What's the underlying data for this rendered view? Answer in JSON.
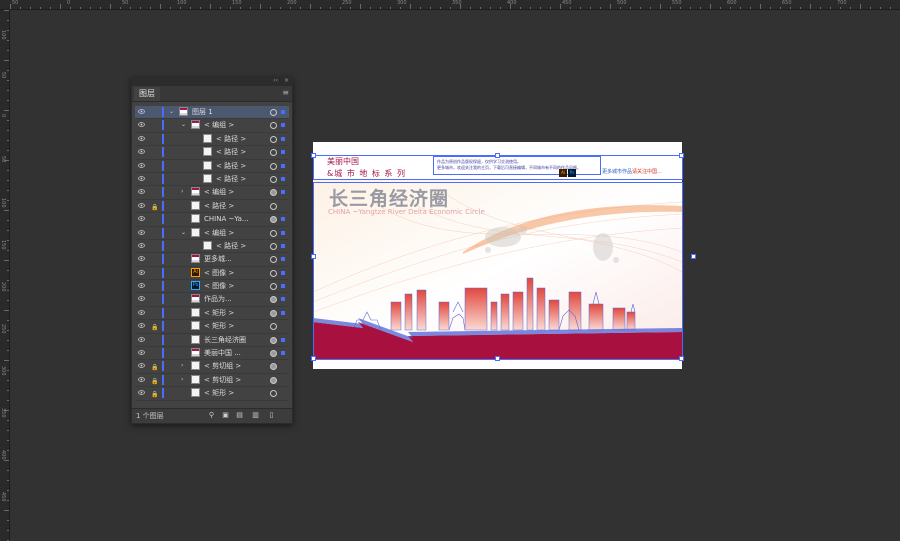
{
  "ruler_top_labels": [
    "50",
    "0",
    "50",
    "100",
    "150",
    "200",
    "250",
    "300",
    "350",
    "400",
    "450",
    "500",
    "550",
    "600",
    "650",
    "700"
  ],
  "ruler_left_labels": [
    "100",
    "50",
    "0",
    "50",
    "100",
    "150",
    "200",
    "250",
    "300",
    "350",
    "400",
    "450"
  ],
  "panel": {
    "tab_label": "图层",
    "collapse_icon": "double-chevron-icon",
    "close_icon": "close-icon",
    "menu_icon": "hamburger-menu-icon",
    "footer_count": "1 个图层",
    "layers": [
      {
        "name": "图层 1",
        "indent": 0,
        "expander": "open",
        "thumb": "doc",
        "lock": false,
        "selected": true,
        "target": "ring",
        "sel": true
      },
      {
        "name": "< 编组 >",
        "indent": 1,
        "expander": "open",
        "thumb": "doc",
        "lock": false,
        "target": "ring",
        "sel": true
      },
      {
        "name": "< 路径 >",
        "indent": 2,
        "expander": "none",
        "thumb": "white",
        "lock": false,
        "target": "ring",
        "sel": true
      },
      {
        "name": "< 路径 >",
        "indent": 2,
        "expander": "none",
        "thumb": "white",
        "lock": false,
        "target": "ring",
        "sel": true
      },
      {
        "name": "< 路径 >",
        "indent": 2,
        "expander": "none",
        "thumb": "white",
        "lock": false,
        "target": "ring",
        "sel": true
      },
      {
        "name": "< 路径 >",
        "indent": 2,
        "expander": "none",
        "thumb": "white",
        "lock": false,
        "target": "ring",
        "sel": true
      },
      {
        "name": "< 编组 >",
        "indent": 1,
        "expander": "closed",
        "thumb": "doc",
        "lock": false,
        "target": "filled",
        "sel": true
      },
      {
        "name": "< 路径 >",
        "indent": 1,
        "expander": "none",
        "thumb": "white",
        "lock": true,
        "target": "ring",
        "sel": false
      },
      {
        "name": "CHINA ~Ya...",
        "indent": 1,
        "expander": "none",
        "thumb": "white",
        "lock": false,
        "target": "filled",
        "sel": true
      },
      {
        "name": "< 编组 >",
        "indent": 1,
        "expander": "open",
        "thumb": "white",
        "lock": false,
        "target": "ring",
        "sel": true
      },
      {
        "name": "< 路径 >",
        "indent": 2,
        "expander": "none",
        "thumb": "white",
        "lock": false,
        "target": "ring",
        "sel": true
      },
      {
        "name": "更多城...",
        "indent": 1,
        "expander": "none",
        "thumb": "doc",
        "lock": false,
        "target": "ring",
        "sel": true
      },
      {
        "name": "< 图像 >",
        "indent": 1,
        "expander": "none",
        "thumb": "ai",
        "lock": false,
        "target": "ring",
        "sel": true
      },
      {
        "name": "< 图像 >",
        "indent": 1,
        "expander": "none",
        "thumb": "ps",
        "lock": false,
        "target": "ring",
        "sel": true
      },
      {
        "name": "作品为...",
        "indent": 1,
        "expander": "none",
        "thumb": "doc",
        "lock": false,
        "target": "filled",
        "sel": true
      },
      {
        "name": "< 矩形 >",
        "indent": 1,
        "expander": "none",
        "thumb": "white",
        "lock": false,
        "target": "filled",
        "sel": true
      },
      {
        "name": "< 矩形 >",
        "indent": 1,
        "expander": "none",
        "thumb": "white",
        "lock": true,
        "target": "ring",
        "sel": false
      },
      {
        "name": "长三角经济圈",
        "indent": 1,
        "expander": "none",
        "thumb": "white",
        "lock": false,
        "target": "filled",
        "sel": true
      },
      {
        "name": "美丽中国 ...",
        "indent": 1,
        "expander": "none",
        "thumb": "doc",
        "lock": false,
        "target": "filled",
        "sel": true
      },
      {
        "name": "< 剪切组 >",
        "indent": 1,
        "expander": "closed",
        "thumb": "white",
        "lock": true,
        "target": "filled",
        "sel": false
      },
      {
        "name": "< 剪切组 >",
        "indent": 1,
        "expander": "closed",
        "thumb": "white",
        "lock": true,
        "target": "filled",
        "sel": false
      },
      {
        "name": "< 矩形 >",
        "indent": 1,
        "expander": "none",
        "thumb": "white",
        "lock": true,
        "target": "ring",
        "sel": false
      }
    ],
    "footer_icons": [
      "search-icon",
      "export-icon",
      "make-clip-mask-icon",
      "new-sublayer-icon",
      "new-layer-icon",
      "trash-icon"
    ]
  },
  "poster": {
    "title_line1": "美丽中国",
    "title_line2": "&城 市 地 标 系 列",
    "notice_line1": "作品为原创作品版权保留，仅供学习交流使用。",
    "notice_line2": "更多城市，欢迎关注我的主页，下载后可直接编辑，不同城市有不同的作品风格。",
    "app_badges": [
      "Ai",
      "Ps"
    ],
    "more_link_prefix": "更多城市作品",
    "more_link_highlight": "请关注中国...",
    "main_title": "长三角经济圈",
    "sub_title": "CHINA ~Yangtze River Delta Economic Circle"
  },
  "colors": {
    "canvas_bg": "#323232",
    "panel_bg": "#424242",
    "selection_blue": "#4a6cff",
    "poster_red": "#a4154f",
    "skyline_red": "#e0483e",
    "skyline_blue": "#5a6ad8"
  }
}
